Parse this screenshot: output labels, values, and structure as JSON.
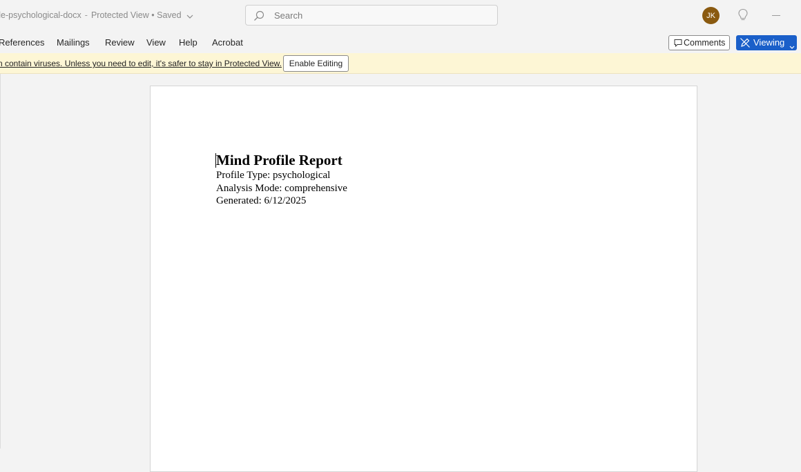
{
  "title_bar": {
    "file_name": "file-psychological-docx",
    "separator": "-",
    "status": "Protected View • Saved",
    "search_placeholder": "Search",
    "user_initials": "JK"
  },
  "ribbon": {
    "tabs": [
      "References",
      "Mailings",
      "Review",
      "View",
      "Help",
      "Acrobat"
    ],
    "comments_label": "Comments",
    "viewing_label": "Viewing"
  },
  "protected_view_bar": {
    "message": "n contain viruses. Unless you need to edit, it's safer to stay in Protected View.",
    "enable_editing_label": "Enable Editing"
  },
  "document": {
    "heading": "Mind Profile Report",
    "lines": [
      "Profile Type: psychological",
      "Analysis Mode: comprehensive",
      "Generated: 6/12/2025"
    ]
  },
  "colors": {
    "accent": "#1a5fc9",
    "avatar": "#8a5a10",
    "message_bar": "#fdf6d5"
  }
}
